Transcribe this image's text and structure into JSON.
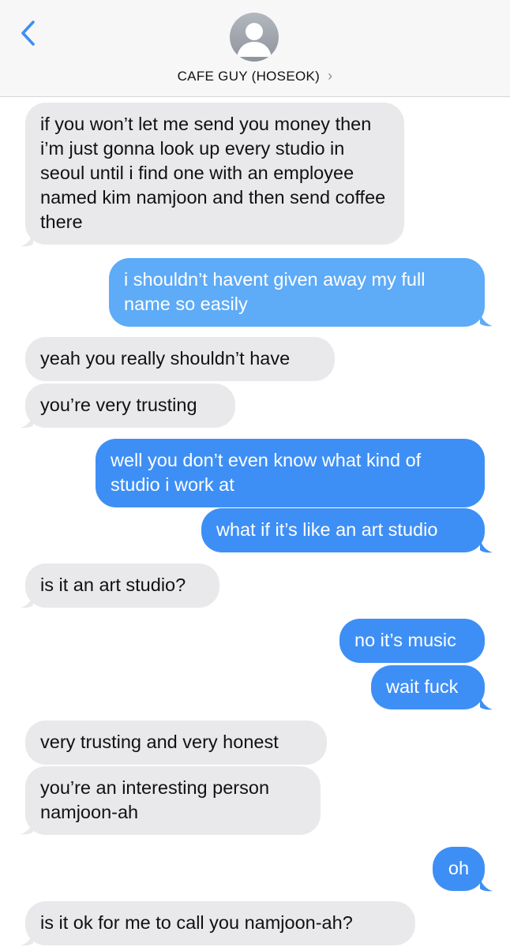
{
  "header": {
    "contact_name": "CAFE GUY (HOSEOK)",
    "chevron": "›",
    "back_icon": "chevron-left-icon",
    "avatar_icon": "person-silhouette-icon",
    "accent_color": "#3e8ff5"
  },
  "colors": {
    "incoming_bubble": "#e9e9eb",
    "outgoing_bubble": "#3e8ff5"
  },
  "messages": [
    {
      "from": "them",
      "text": "if you won’t let me send you money then i’m just gonna look up every studio in seoul until i find one with an employee named kim namjoon and then send coffee there"
    },
    {
      "from": "me",
      "text": "i shouldn’t havent given away my full name so easily"
    },
    {
      "from": "them",
      "text": "yeah you really shouldn’t have"
    },
    {
      "from": "them",
      "text": "you’re very trusting"
    },
    {
      "from": "me",
      "text": "well you don’t even know what kind of studio i work at"
    },
    {
      "from": "me",
      "text": "what if it’s like an art studio"
    },
    {
      "from": "them",
      "text": "is it an art studio?"
    },
    {
      "from": "me",
      "text": "no it’s music"
    },
    {
      "from": "me",
      "text": "wait fuck"
    },
    {
      "from": "them",
      "text": "very trusting and very honest"
    },
    {
      "from": "them",
      "text": "you’re an interesting person namjoon-ah"
    },
    {
      "from": "me",
      "text": "oh"
    },
    {
      "from": "them",
      "text": "is it ok for me to call you namjoon-ah?"
    }
  ]
}
